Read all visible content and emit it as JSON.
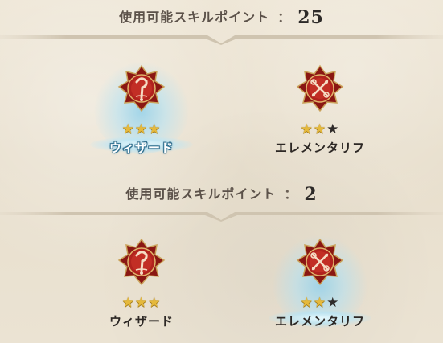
{
  "sections": [
    {
      "label": "使用可能スキルポイント",
      "colon": "：",
      "value": "25",
      "classes": [
        {
          "name": "ウィザード",
          "stars": 3,
          "max_stars": 3,
          "selected": true,
          "icon": "wizard-emblem-icon"
        },
        {
          "name": "エレメンタリフ",
          "stars": 2,
          "max_stars": 3,
          "selected": false,
          "icon": "elementalist-emblem-icon"
        }
      ]
    },
    {
      "label": "使用可能スキルポイント",
      "colon": "：",
      "value": "2",
      "classes": [
        {
          "name": "ウィザード",
          "stars": 3,
          "max_stars": 3,
          "selected": false,
          "icon": "wizard-emblem-icon"
        },
        {
          "name": "エレメンタリフ",
          "stars": 2,
          "max_stars": 3,
          "selected": true,
          "icon": "elementalist-emblem-icon"
        }
      ]
    }
  ],
  "colors": {
    "emblem_red": "#b1231e",
    "emblem_dark": "#6d0f0d",
    "emblem_gold": "#caa25a",
    "star_gold": "#e5b93c",
    "header_text": "#5c524a",
    "glow": "#a8dcf0"
  }
}
